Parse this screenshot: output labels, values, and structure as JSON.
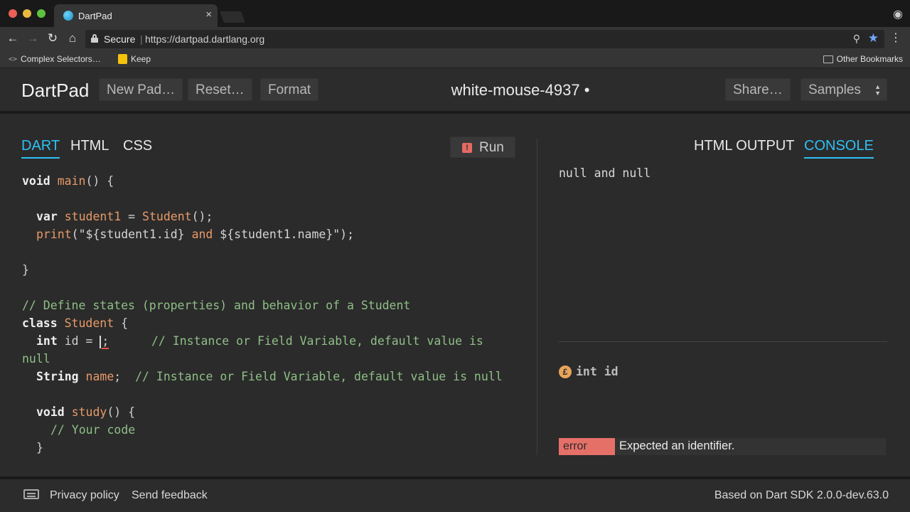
{
  "browser": {
    "tab_title": "DartPad",
    "tab_close": "×",
    "secure_label": "Secure",
    "url": "https://dartpad.dartlang.org",
    "bookmarks": [
      "Complex Selectors…",
      "Keep"
    ],
    "other_bookmarks": "Other Bookmarks",
    "bm_code_glyph": "<>"
  },
  "header": {
    "logo": "DartPad",
    "new_pad": "New Pad…",
    "reset": "Reset…",
    "format": "Format",
    "pad_title": "white-mouse-4937 •",
    "share": "Share…",
    "samples": "Samples"
  },
  "editor": {
    "tabs": [
      "DART",
      "HTML",
      "CSS"
    ],
    "active_tab": "DART",
    "run_label": "Run",
    "run_error_glyph": "!"
  },
  "code": {
    "l1_void": "void",
    "l1_main": "main",
    "l1_rest": "() {",
    "l3_var": "var",
    "l3_student1": "student1",
    "l3_eq": " = ",
    "l3_Student": "Student",
    "l3_rest": "();",
    "l4_print": "print",
    "l4_open": "(\"${student1.id} ",
    "l4_and": "and",
    "l4_close": " ${student1.name}\");",
    "l6_brace": "}",
    "l8_comment": "// Define states (properties) and behavior of a Student",
    "l9_class": "class",
    "l9_Student": "Student",
    "l9_brace": " {",
    "l10_int": "int",
    "l10_id": " id = ",
    "l10_semi": ";",
    "l10_comment": "      // Instance or Field Variable, default value is",
    "l11_wrap": "null",
    "l12_String": "String",
    "l12_name": "name",
    "l12_semi": ";  ",
    "l12_comment": "// Instance or Field Variable, default value is null",
    "l14_void": "void",
    "l14_study": "study",
    "l14_rest": "() {",
    "l15_comment": "// Your code",
    "l16_brace": "}"
  },
  "output": {
    "tabs": [
      "HTML OUTPUT",
      "CONSOLE"
    ],
    "active_tab": "CONSOLE",
    "console_text": "null and null",
    "doc_icon_glyph": "£",
    "doc_text": "int id",
    "issue_badge": "error",
    "issue_message": "Expected an identifier."
  },
  "footer": {
    "privacy": "Privacy policy",
    "feedback": "Send feedback",
    "sdk": "Based on Dart SDK 2.0.0-dev.63.0"
  },
  "colors": {
    "accent": "#2ec1f5",
    "error": "#e57068",
    "keyword_orange": "#e89a68",
    "comment_green": "#8fbf87"
  }
}
